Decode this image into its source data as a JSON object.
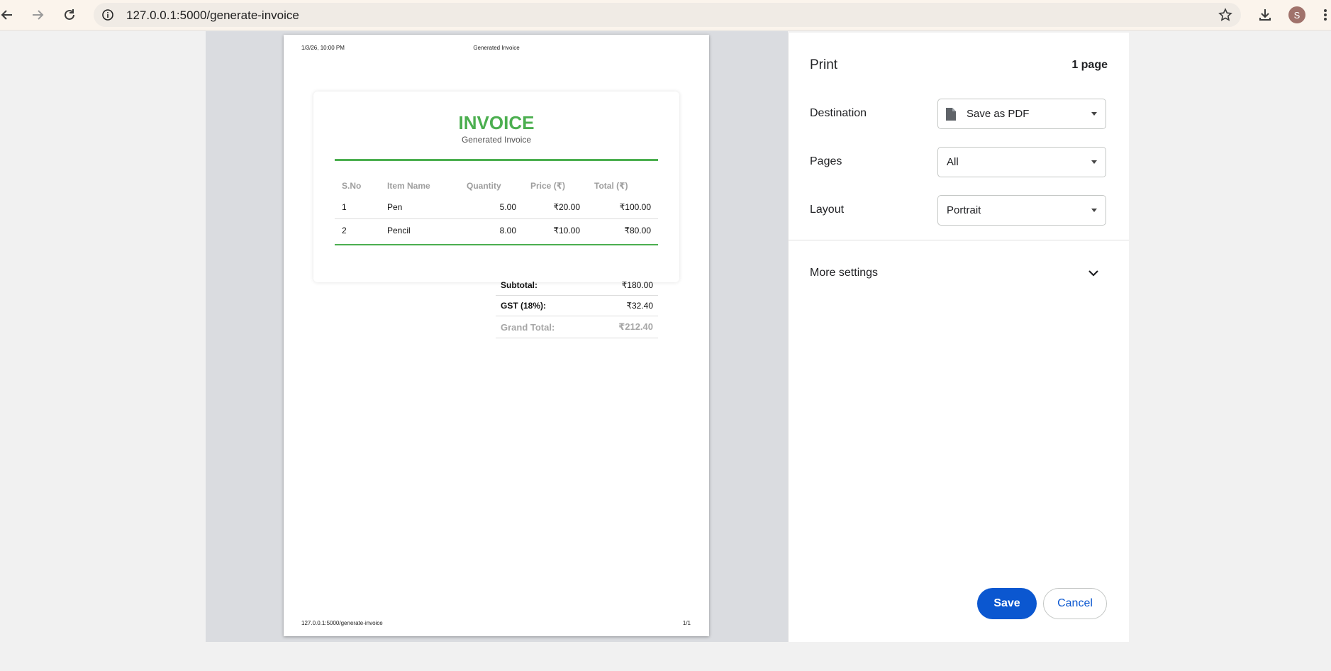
{
  "browser": {
    "url": "127.0.0.1:5000/generate-invoice",
    "profile_initial": "S",
    "icons": [
      "back-icon",
      "forward-icon",
      "reload-icon",
      "info-icon",
      "star-icon",
      "download-icon",
      "menu-icon"
    ]
  },
  "preview": {
    "header_date": "1/3/26, 10:00 PM",
    "header_title": "Generated Invoice",
    "footer_url": "127.0.0.1:5000/generate-invoice",
    "footer_page": "1/1",
    "invoice": {
      "title": "INVOICE",
      "subtitle": "Generated Invoice",
      "accent_color": "#4caf50",
      "columns": [
        "S.No",
        "Item Name",
        "Quantity",
        "Price (₹)",
        "Total (₹)"
      ],
      "rows": [
        {
          "sno": "1",
          "name": "Pen",
          "qty": "5.00",
          "price": "₹20.00",
          "total": "₹100.00"
        },
        {
          "sno": "2",
          "name": "Pencil",
          "qty": "8.00",
          "price": "₹10.00",
          "total": "₹80.00"
        }
      ],
      "subtotal_label": "Subtotal:",
      "subtotal_value": "₹180.00",
      "gst_label": "GST (18%):",
      "gst_value": "₹32.40",
      "grand_label": "Grand Total:",
      "grand_value": "₹212.40"
    }
  },
  "print": {
    "title": "Print",
    "page_count": "1 page",
    "destination_label": "Destination",
    "destination_value": "Save as PDF",
    "pages_label": "Pages",
    "pages_value": "All",
    "layout_label": "Layout",
    "layout_value": "Portrait",
    "more_settings": "More settings",
    "save_label": "Save",
    "cancel_label": "Cancel",
    "primary_color": "#0b57d0"
  }
}
